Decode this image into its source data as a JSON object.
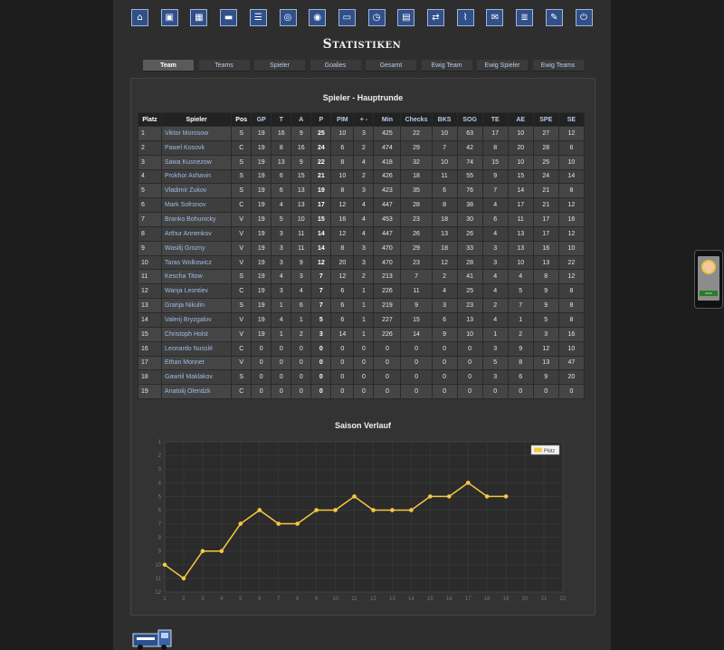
{
  "nav_icons": [
    {
      "name": "home-icon",
      "glyph": "⌂"
    },
    {
      "name": "team-icon",
      "glyph": "▣"
    },
    {
      "name": "lineup-icon",
      "glyph": "▦"
    },
    {
      "name": "training-icon",
      "glyph": "▬"
    },
    {
      "name": "list-icon",
      "glyph": "☰"
    },
    {
      "name": "versus-icon",
      "glyph": "◎"
    },
    {
      "name": "versus-stats-icon",
      "glyph": "◉"
    },
    {
      "name": "rink-icon",
      "glyph": "▭"
    },
    {
      "name": "clock-icon",
      "glyph": "◷"
    },
    {
      "name": "office-icon",
      "glyph": "▤"
    },
    {
      "name": "transfer-icon",
      "glyph": "⇄"
    },
    {
      "name": "chart-icon",
      "glyph": "⌇"
    },
    {
      "name": "mail-icon",
      "glyph": "✉"
    },
    {
      "name": "document-icon",
      "glyph": "≣"
    },
    {
      "name": "chat-icon",
      "glyph": "✎"
    },
    {
      "name": "logout-icon",
      "glyph": "⏻"
    }
  ],
  "page_title": "Statistiken",
  "tabs": [
    "Team",
    "Teams",
    "Spieler",
    "Goalies",
    "Gesamt",
    "Ewig Team",
    "Ewig Spieler",
    "Ewig Teams"
  ],
  "active_tab": 0,
  "table_title": "Spieler - Hauptrunde",
  "columns": [
    "Platz",
    "Spieler",
    "Pos",
    "GP",
    "T",
    "A",
    "P",
    "PIM",
    "+ -",
    "Min",
    "Checks",
    "BKS",
    "SOG",
    "TE",
    "AE",
    "SPE",
    "SE"
  ],
  "rows": [
    [
      "1",
      "Viktor Morosow",
      "S",
      "19",
      "16",
      "9",
      "25",
      "10",
      "3",
      "425",
      "22",
      "10",
      "63",
      "17",
      "10",
      "27",
      "12"
    ],
    [
      "2",
      "Pawel Kosovk",
      "C",
      "19",
      "8",
      "16",
      "24",
      "6",
      "2",
      "474",
      "29",
      "7",
      "42",
      "8",
      "20",
      "28",
      "6"
    ],
    [
      "3",
      "Sawa Kusnezow",
      "S",
      "19",
      "13",
      "9",
      "22",
      "8",
      "4",
      "418",
      "32",
      "10",
      "74",
      "15",
      "10",
      "25",
      "10"
    ],
    [
      "4",
      "Prokhor Ashavin",
      "S",
      "19",
      "6",
      "15",
      "21",
      "10",
      "2",
      "426",
      "18",
      "11",
      "55",
      "9",
      "15",
      "24",
      "14"
    ],
    [
      "5",
      "Vladimir Zukov",
      "S",
      "19",
      "6",
      "13",
      "19",
      "8",
      "3",
      "423",
      "35",
      "6",
      "76",
      "7",
      "14",
      "21",
      "8"
    ],
    [
      "6",
      "Mark Sofronov",
      "C",
      "19",
      "4",
      "13",
      "17",
      "12",
      "4",
      "447",
      "28",
      "8",
      "38",
      "4",
      "17",
      "21",
      "12"
    ],
    [
      "7",
      "Branko Bohunicky",
      "V",
      "19",
      "5",
      "10",
      "15",
      "16",
      "4",
      "453",
      "23",
      "18",
      "30",
      "6",
      "11",
      "17",
      "16"
    ],
    [
      "8",
      "Arthur Annenkov",
      "V",
      "19",
      "3",
      "11",
      "14",
      "12",
      "4",
      "447",
      "26",
      "13",
      "26",
      "4",
      "13",
      "17",
      "12"
    ],
    [
      "9",
      "Wasilij Grozny",
      "V",
      "19",
      "3",
      "11",
      "14",
      "8",
      "3",
      "470",
      "29",
      "18",
      "33",
      "3",
      "13",
      "16",
      "10"
    ],
    [
      "10",
      "Taras Wolkowicz",
      "V",
      "19",
      "3",
      "9",
      "12",
      "20",
      "3",
      "470",
      "23",
      "12",
      "28",
      "3",
      "10",
      "13",
      "22"
    ],
    [
      "11",
      "Kescha Titow",
      "S",
      "19",
      "4",
      "3",
      "7",
      "12",
      "2",
      "213",
      "7",
      "2",
      "41",
      "4",
      "4",
      "8",
      "12"
    ],
    [
      "12",
      "Wanja Leontiev",
      "C",
      "19",
      "3",
      "4",
      "7",
      "6",
      "1",
      "226",
      "11",
      "4",
      "25",
      "4",
      "5",
      "9",
      "8"
    ],
    [
      "13",
      "Granja Nikulin",
      "S",
      "19",
      "1",
      "6",
      "7",
      "6",
      "1",
      "219",
      "9",
      "3",
      "23",
      "2",
      "7",
      "9",
      "8"
    ],
    [
      "14",
      "Valerij Bryzgalov",
      "V",
      "19",
      "4",
      "1",
      "5",
      "6",
      "1",
      "227",
      "15",
      "6",
      "13",
      "4",
      "1",
      "5",
      "8"
    ],
    [
      "15",
      "Christoph Holst",
      "V",
      "19",
      "1",
      "2",
      "3",
      "14",
      "1",
      "226",
      "14",
      "9",
      "10",
      "1",
      "2",
      "3",
      "16"
    ],
    [
      "16",
      "Leonardo Nusslé",
      "C",
      "0",
      "0",
      "0",
      "0",
      "0",
      "0",
      "0",
      "0",
      "0",
      "0",
      "3",
      "9",
      "12",
      "10"
    ],
    [
      "17",
      "Ethan Monnet",
      "V",
      "0",
      "0",
      "0",
      "0",
      "0",
      "0",
      "0",
      "0",
      "0",
      "0",
      "5",
      "8",
      "13",
      "47"
    ],
    [
      "18",
      "Gawriil Maklakov",
      "S",
      "0",
      "0",
      "0",
      "0",
      "0",
      "0",
      "0",
      "0",
      "0",
      "0",
      "3",
      "6",
      "9",
      "20"
    ],
    [
      "19",
      "Anatolij Olendzk",
      "C",
      "0",
      "0",
      "0",
      "0",
      "0",
      "0",
      "0",
      "0",
      "0",
      "0",
      "0",
      "0",
      "0",
      "0"
    ]
  ],
  "chart_data": {
    "type": "line",
    "title": "Saison Verlauf",
    "x": [
      1,
      2,
      3,
      4,
      5,
      6,
      7,
      8,
      9,
      10,
      11,
      12,
      13,
      14,
      15,
      16,
      17,
      18,
      19
    ],
    "x_ticks": [
      "1",
      "2",
      "3",
      "4",
      "5",
      "6",
      "7",
      "8",
      "9",
      "10",
      "11",
      "12",
      "13",
      "14",
      "15",
      "16",
      "17",
      "18",
      "19",
      "20",
      "21",
      "22"
    ],
    "y_ticks": [
      "1",
      "2",
      "3",
      "4",
      "5",
      "6",
      "7",
      "8",
      "9",
      "10",
      "11",
      "12"
    ],
    "ylim": [
      1,
      12
    ],
    "y_inverted": true,
    "grid": true,
    "legend_position": "top-right",
    "series": [
      {
        "name": "Platz",
        "color": "#f5c842",
        "values": [
          10,
          11,
          9,
          9,
          7,
          6,
          7,
          7,
          6,
          6,
          5,
          6,
          6,
          6,
          5,
          5,
          4,
          5,
          5
        ]
      }
    ]
  },
  "colors": {
    "accent": "#f5c842",
    "link": "#9fbbe6",
    "tab_text": "#b9cdea"
  },
  "phone_button_label": "CHAT"
}
